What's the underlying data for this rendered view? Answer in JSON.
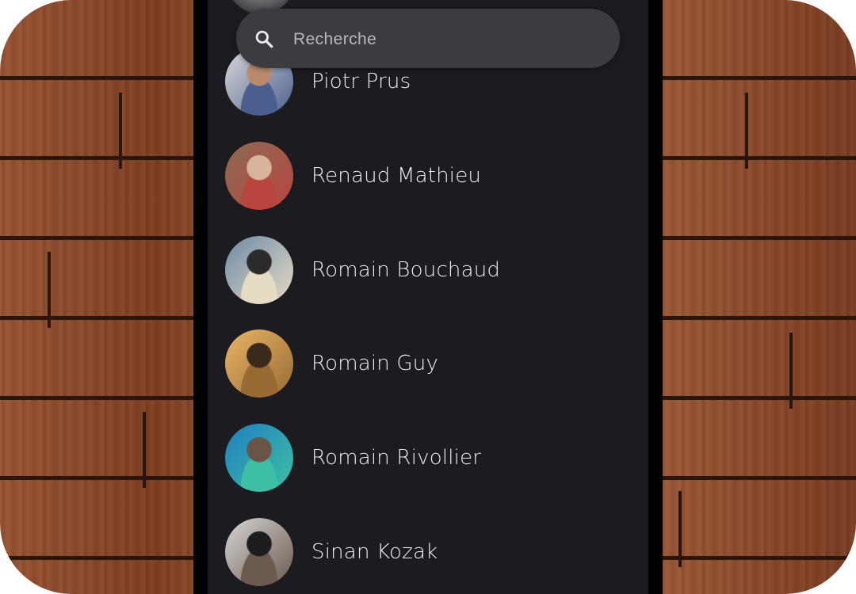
{
  "search": {
    "placeholder": "Recherche",
    "icon": "search-icon"
  },
  "contacts": [
    {
      "name": "Piotr Prus",
      "avatar_colors": [
        "#d9d9d9",
        "#4b5f8f",
        "#b98a6e"
      ]
    },
    {
      "name": "Renaud Mathieu",
      "avatar_colors": [
        "#8c6a52",
        "#b9453f",
        "#d8b59a"
      ]
    },
    {
      "name": "Romain Bouchaud",
      "avatar_colors": [
        "#6e8aa8",
        "#e6dcc4",
        "#2b2b2b"
      ]
    },
    {
      "name": "Romain Guy",
      "avatar_colors": [
        "#e8b566",
        "#9a6a34",
        "#3b2a1c"
      ]
    },
    {
      "name": "Romain Rivollier",
      "avatar_colors": [
        "#1f7fc1",
        "#3fbfa3",
        "#6a5446"
      ]
    },
    {
      "name": "Sinan Kozak",
      "avatar_colors": [
        "#d7d5d2",
        "#6b5a50",
        "#1d1d1f"
      ]
    }
  ],
  "colors": {
    "screen_bg": "#1c1b20",
    "search_bg": "#3b3b40",
    "text": "#efeef1",
    "wood": "#8a4a2c"
  }
}
